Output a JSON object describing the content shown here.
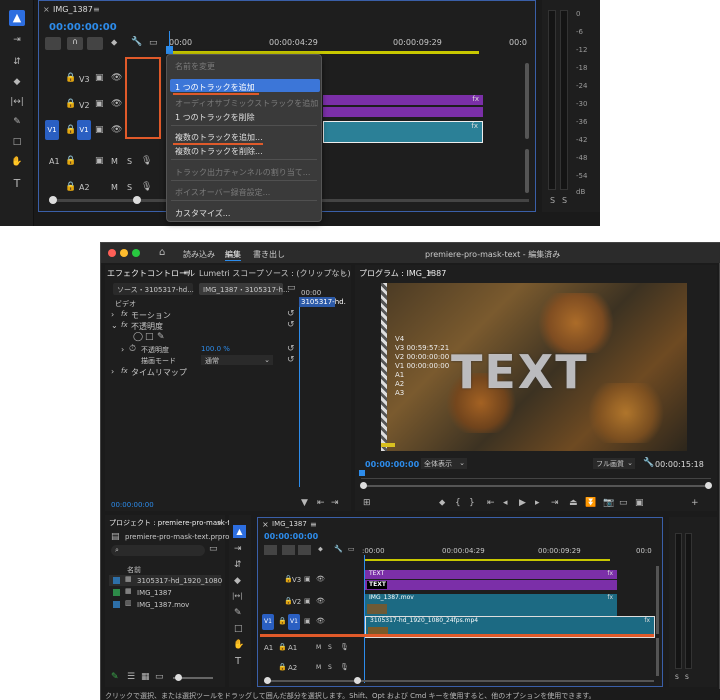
{
  "top": {
    "tab_title": "IMG_1387",
    "timecode": "00:00:00:00",
    "ruler": [
      "00:00",
      "00:00:04:29",
      "00:00:09:29",
      "00:0"
    ],
    "tracks": [
      {
        "name": "V3",
        "toggle": ""
      },
      {
        "name": "V2",
        "toggle": ""
      },
      {
        "name": "V1",
        "toggle": "V1"
      },
      {
        "name": "A1",
        "toggle": ""
      },
      {
        "name": "A2",
        "toggle": ""
      }
    ],
    "audio_flags": [
      "M",
      "S"
    ],
    "fx": "fx",
    "context_menu": [
      {
        "label": "名前を変更",
        "disabled": true
      },
      {
        "label": "1 つのトラックを追加",
        "disabled": false,
        "selected": true
      },
      {
        "label": "オーディオサブミックストラックを追加",
        "disabled": true
      },
      {
        "label": "1 つのトラックを削除",
        "disabled": false
      },
      {
        "label": "複数のトラックを追加...",
        "disabled": false,
        "underline": true
      },
      {
        "label": "複数のトラックを削除...",
        "disabled": false
      },
      {
        "label": "トラック出力チャンネルの割り当て...",
        "disabled": true
      },
      {
        "label": "ボイスオーバー録音設定...",
        "disabled": true
      },
      {
        "label": "カスタマイズ...",
        "disabled": false
      }
    ],
    "meter_ticks": [
      "0",
      "-6",
      "-12",
      "-18",
      "-24",
      "-30",
      "-36",
      "-42",
      "-48",
      "-54",
      "dB"
    ],
    "meter_s": [
      "S",
      "S"
    ]
  },
  "bottom": {
    "title_bar": "premiere-pro-mask-text - 編集済み",
    "workspaces": [
      "読み込み",
      "編集",
      "書き出し"
    ],
    "left_tabs": [
      "エフェクトコントロール",
      "Lumetri スコープ",
      "ソース : (クリップなし)"
    ],
    "source_label": "ソース・3105317-hd...",
    "seq_label": "IMG_1387・3105317-h...",
    "ec_timecode_top": "00:00",
    "clip_tag": "3105317-hd.",
    "ec_rows": {
      "video": "ビデオ",
      "motion": "モーション",
      "opacity": "不透明度",
      "opacity_prop": "不透明度",
      "opacity_value": "100.0 %",
      "blend_mode": "描画モード",
      "blend_value": "通常",
      "time_remap": "タイムリマップ"
    },
    "ec_timecode_bottom": "00:00:00:00",
    "program": {
      "title": "プログラム : IMG_1387",
      "overlay": [
        "V4",
        "V3 00:59:57:21",
        "V2 00:00:00:00",
        "V1 00:00:00:00",
        "A1",
        "A2",
        "A3"
      ],
      "text": "TEXT",
      "timecode": "00:00:00:00",
      "zoom": "全体表示",
      "quality": "フル画質",
      "duration": "00:00:15:18"
    },
    "project": {
      "tab": "プロジェクト : premiere-pro-mask-text",
      "file": "premiere-pro-mask-text.prproj",
      "name_header": "名前",
      "items": [
        "3105317-hd_1920_1080",
        "IMG_1387",
        "IMG_1387.mov"
      ]
    },
    "timeline": {
      "tab": "IMG_1387",
      "timecode": "00:00:00:00",
      "ruler": [
        ":00:00",
        "00:00:04:29",
        "00:00:09:29",
        "00:0"
      ],
      "tracks": [
        {
          "name": "V3",
          "toggle": ""
        },
        {
          "name": "V2",
          "toggle": ""
        },
        {
          "name": "V1",
          "toggle": "V1"
        },
        {
          "name": "A1",
          "toggle": ""
        },
        {
          "name": "A2",
          "toggle": ""
        }
      ],
      "clips": {
        "v3_text": "TEXT",
        "v3_text2": "TEXT",
        "v2_clip": "IMG_1387.mov",
        "v1_clip": "3105317-hd_1920_1080_24fps.mp4"
      },
      "fx": "fx"
    },
    "meter_s": [
      "S",
      "S"
    ],
    "status": "クリックで選択、または選択ツールをドラッグして囲んだ部分を選択します。Shift、Opt および Cmd キーを使用すると、他のオプションを使用できます。"
  },
  "colors": {
    "accent_blue": "#2d8ceb",
    "red_annotation": "#e05a2a",
    "clip_purple": "#7b2fa8",
    "clip_teal": "#1c6a83"
  }
}
